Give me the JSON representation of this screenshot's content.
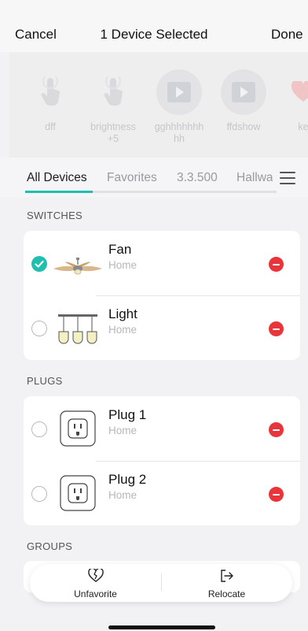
{
  "header": {
    "cancel_label": "Cancel",
    "title": "1 Device Selected",
    "done_label": "Done"
  },
  "scenes": [
    {
      "label": "dff",
      "icon": "tap-hand-icon"
    },
    {
      "label": "brightness+5",
      "icon": "tap-hand-icon"
    },
    {
      "label": "gghhhhhhhhh",
      "icon": "play-icon"
    },
    {
      "label": "ffdshow",
      "icon": "play-icon"
    },
    {
      "label": "ke",
      "icon": "heart-icon"
    }
  ],
  "tabs": [
    {
      "label": "All Devices",
      "active": true
    },
    {
      "label": "Favorites"
    },
    {
      "label": "3.3.500"
    },
    {
      "label": "Hallway"
    }
  ],
  "sections": {
    "switches": {
      "title": "SWITCHES",
      "devices": [
        {
          "name": "Fan",
          "location": "Home",
          "selected": true,
          "icon": "ceiling-fan-icon"
        },
        {
          "name": "Light",
          "location": "Home",
          "selected": false,
          "icon": "pendant-light-icon"
        }
      ]
    },
    "plugs": {
      "title": "PLUGS",
      "devices": [
        {
          "name": "Plug 1",
          "location": "Home",
          "selected": false,
          "icon": "smart-plug-icon"
        },
        {
          "name": "Plug 2",
          "location": "Home",
          "selected": false,
          "icon": "smart-plug-icon"
        }
      ]
    },
    "groups": {
      "title": "GROUPS"
    }
  },
  "actions": {
    "unfavorite_label": "Unfavorite",
    "relocate_label": "Relocate"
  },
  "colors": {
    "accent": "#1fbfb0",
    "remove": "#e8353b",
    "muted_text": "#b7b7bb"
  }
}
